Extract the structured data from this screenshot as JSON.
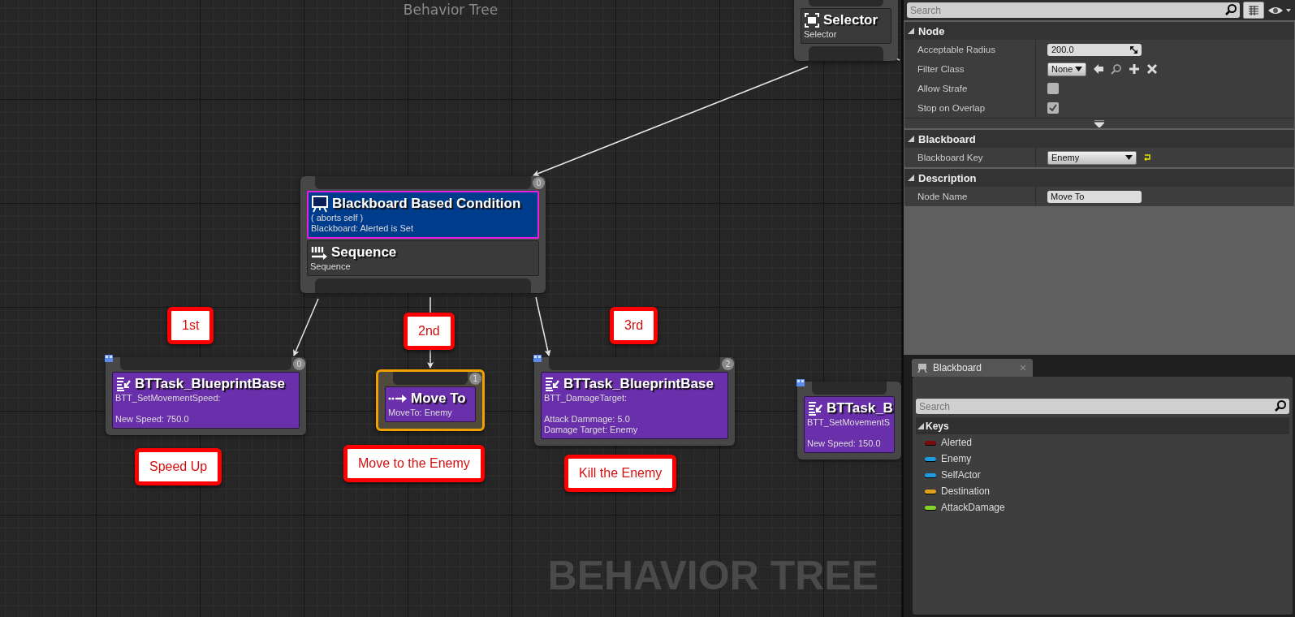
{
  "canvas": {
    "title": "Behavior Tree",
    "watermark": "BEHAVIOR TREE",
    "nodes": [
      {
        "kind": "selector",
        "title": "Selector",
        "lines": [
          "Selector"
        ],
        "selected": false
      },
      {
        "kind": "sequence",
        "title": "Sequence",
        "lines": [
          "Sequence"
        ],
        "index": "0",
        "selected": false,
        "decorator": {
          "title": "Blackboard Based Condition",
          "lines": [
            "( aborts self )",
            "Blackboard: Alerted is Set"
          ],
          "highlighted": true
        }
      },
      {
        "kind": "task",
        "title": "BTTask_BlueprintBase",
        "lines": [
          "BTT_SetMovementSpeed:"
        ],
        "details": [
          "New Speed: 750.0"
        ],
        "index": "0",
        "selected": false
      },
      {
        "kind": "move_to",
        "title": "Move To",
        "lines": [
          "MoveTo: Enemy"
        ],
        "index": "1",
        "selected": true
      },
      {
        "kind": "task",
        "title": "BTTask_BlueprintBase",
        "lines": [
          "BTT_DamageTarget:"
        ],
        "details": [
          "Attack Dammage: 5.0",
          "Damage Target: Enemy"
        ],
        "index": "2",
        "selected": false
      },
      {
        "kind": "task",
        "title": "BTTask_B",
        "lines": [
          "BTT_SetMovementS"
        ],
        "details": [
          "New Speed: 150.0"
        ],
        "selected": false
      }
    ],
    "annotations": [
      {
        "text": "1st"
      },
      {
        "text": "2nd"
      },
      {
        "text": "3rd"
      },
      {
        "text": "Speed Up"
      },
      {
        "text": "Move to the Enemy"
      },
      {
        "text": "Kill the Enemy"
      }
    ]
  },
  "details": {
    "search": {
      "placeholder": "Search"
    },
    "sections": [
      {
        "title": "Node",
        "expanded": true,
        "advanced": true,
        "rows": [
          {
            "label": "Acceptable Radius",
            "kind": "number",
            "value": "200.0"
          },
          {
            "label": "Filter Class",
            "kind": "class",
            "value": "None"
          },
          {
            "label": "Allow Strafe",
            "kind": "checkbox",
            "checked": false
          },
          {
            "label": "Stop on Overlap",
            "kind": "checkbox",
            "checked": true
          }
        ]
      },
      {
        "title": "Blackboard",
        "expanded": true,
        "rows": [
          {
            "label": "Blackboard Key",
            "kind": "dropdown",
            "value": "Enemy"
          }
        ]
      },
      {
        "title": "Description",
        "expanded": true,
        "rows": [
          {
            "label": "Node Name",
            "kind": "text",
            "value": "Move To"
          }
        ]
      }
    ]
  },
  "blackboard": {
    "tab": {
      "label": "Blackboard",
      "selected": true
    },
    "search": {
      "placeholder": "Search"
    },
    "group": {
      "title": "Keys",
      "expanded": true,
      "keys": [
        {
          "name": "Alerted",
          "color": "#7a0c0c"
        },
        {
          "name": "Enemy",
          "color": "#1f9be0"
        },
        {
          "name": "SelfActor",
          "color": "#1f9be0"
        },
        {
          "name": "Destination",
          "color": "#e0a218"
        },
        {
          "name": "AttackDamage",
          "color": "#86d42a"
        }
      ]
    }
  }
}
